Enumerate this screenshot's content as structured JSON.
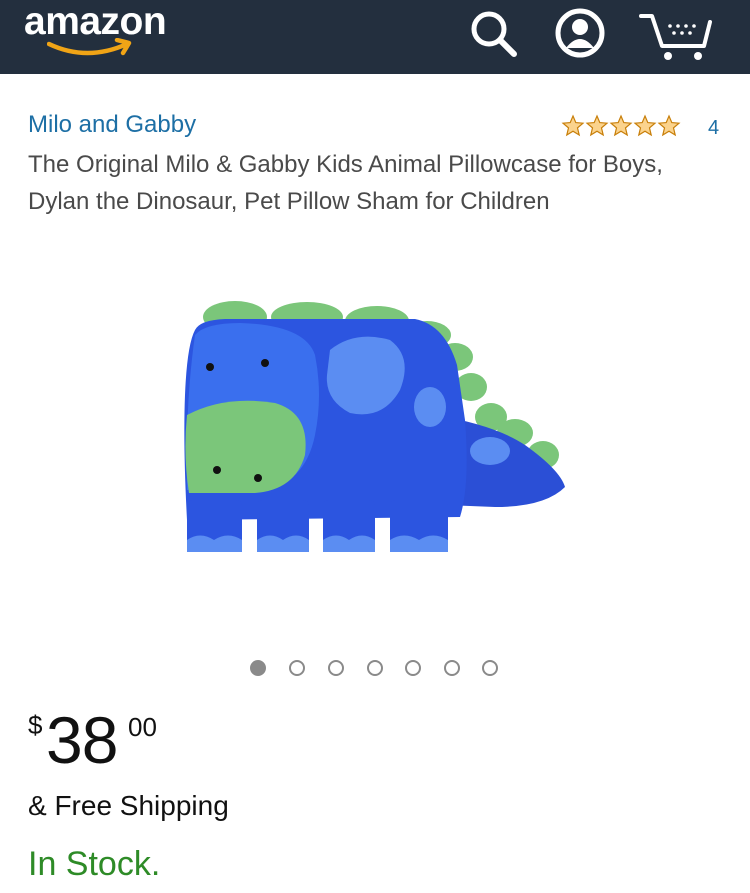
{
  "header": {
    "logo_text": "amazon",
    "icons": [
      "search-icon",
      "account-icon",
      "cart-icon"
    ]
  },
  "product": {
    "brand": "Milo and Gabby",
    "rating": {
      "stars": 5,
      "count": "4"
    },
    "title": "The Original Milo & Gabby Kids Animal Pillowcase for Boys, Dylan the Dinosaur, Pet Pillow Sham for Children",
    "image_subject": "blue-dinosaur-pillowcase",
    "carousel": {
      "total": 7,
      "active_index": 0
    },
    "price": {
      "currency": "$",
      "whole": "38",
      "fraction": "00"
    },
    "shipping": "& Free Shipping",
    "availability": "In Stock."
  },
  "colors": {
    "header_bg": "#232f3e",
    "link": "#1d6fa5",
    "star": "#f0a416",
    "in_stock": "#2e8b27",
    "smile": "#f0a416"
  }
}
